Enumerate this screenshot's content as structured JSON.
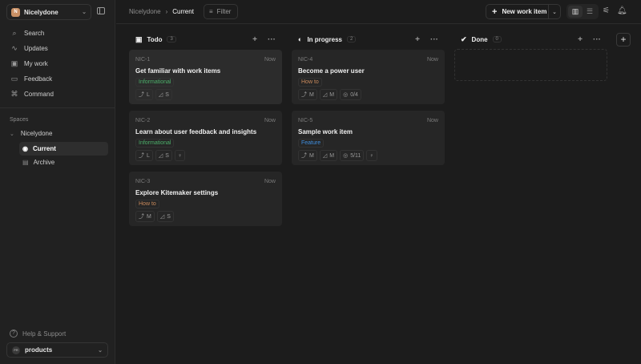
{
  "workspace": {
    "name": "Nicelydone",
    "initial": "N"
  },
  "nav": [
    {
      "label": "Search",
      "icon": "search-icon",
      "glyph": "⌕"
    },
    {
      "label": "Updates",
      "icon": "activity-icon",
      "glyph": "∿"
    },
    {
      "label": "My work",
      "icon": "my-work-icon",
      "glyph": "▣"
    },
    {
      "label": "Feedback",
      "icon": "feedback-icon",
      "glyph": "▭"
    },
    {
      "label": "Command",
      "icon": "command-icon",
      "glyph": "⌘"
    }
  ],
  "spaces": {
    "label": "Spaces",
    "name": "Nicelydone",
    "items": [
      {
        "label": "Current"
      },
      {
        "label": "Archive"
      }
    ]
  },
  "help": "Help & Support",
  "team": {
    "name": "products",
    "initials": "PR"
  },
  "header": {
    "breadcrumb": [
      "Nicelydone",
      "Current"
    ],
    "filter": "Filter",
    "new_item": "New work item"
  },
  "columns": [
    {
      "name": "Todo",
      "count": "3",
      "cards": [
        {
          "id": "NIC-1",
          "time": "Now",
          "title": "Get familiar with work items",
          "tag": "Informational",
          "tag_color": "#4caf6a",
          "props": [
            "L",
            "S"
          ]
        },
        {
          "id": "NIC-2",
          "time": "Now",
          "title": "Learn about user feedback and insights",
          "tag": "Informational",
          "tag_color": "#4caf6a",
          "props": [
            "L",
            "S"
          ],
          "bulb": true
        },
        {
          "id": "NIC-3",
          "time": "Now",
          "title": "Explore Kitemaker settings",
          "tag": "How to",
          "tag_color": "#c98a5c",
          "props": [
            "M",
            "S"
          ]
        }
      ]
    },
    {
      "name": "In progress",
      "count": "2",
      "cards": [
        {
          "id": "NIC-4",
          "time": "Now",
          "title": "Become a power user",
          "tag": "How to",
          "tag_color": "#c98a5c",
          "props": [
            "M",
            "M"
          ],
          "progress": "0/4"
        },
        {
          "id": "NIC-5",
          "time": "Now",
          "title": "Sample work item",
          "tag": "Feature",
          "tag_color": "#3f8fe0",
          "props": [
            "M",
            "M"
          ],
          "progress": "5/11",
          "bulb": true
        }
      ]
    },
    {
      "name": "Done",
      "count": "0",
      "cards": []
    }
  ]
}
